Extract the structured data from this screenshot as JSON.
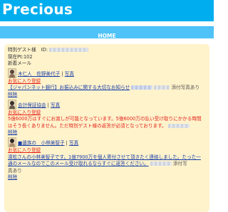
{
  "app": {
    "logo": "Precious"
  },
  "nav": {
    "home": "HOME"
  },
  "user": {
    "label": "特別ゲスト様",
    "id_label": "ID:",
    "points_label": "現在Pt:",
    "points": "102",
    "section_title": "新着メール"
  },
  "messages": [
    {
      "sender": "木仁人　佐野美代子",
      "photo_link": "写真",
      "fav_link": "お気に入り登録",
      "body_lines": [
        "【ジャパンネット銀行】お振込みに関する大切なお知らせ"
      ],
      "suffix": "添付写真あり",
      "delete": "削除"
    },
    {
      "sender": "会計保証協会",
      "photo_link": "写真",
      "fav_link": "お気に入り登録",
      "body_lines": [
        "5億6000万はすぐにお渡しが可能となっています。5億6000万の払い受け取りにかかる時間",
        "はそう長くありません。ただ特別ゲスト様の返答が必須となっております。"
      ],
      "suffix": "",
      "delete": "削除"
    },
    {
      "sender": "■遺族の　小林美智子",
      "photo_link": "写真",
      "fav_link": "お気に入り登録",
      "body_lines": [
        "濱松さんの小林美智子です。1億7900万を個人寄付させて頂きたく連絡しました。たった一",
        "通のメールなのでこのメール受け取れるならすぐに返答ください。"
      ],
      "suffix": "添付写",
      "suffix2": "真あり",
      "delete": "削除"
    }
  ],
  "colors": {
    "header": "#00aeef",
    "nav": "#4fc3f7",
    "panel": "#fff3cc",
    "link": "#1a3fa8",
    "warning": "#e2231a"
  }
}
